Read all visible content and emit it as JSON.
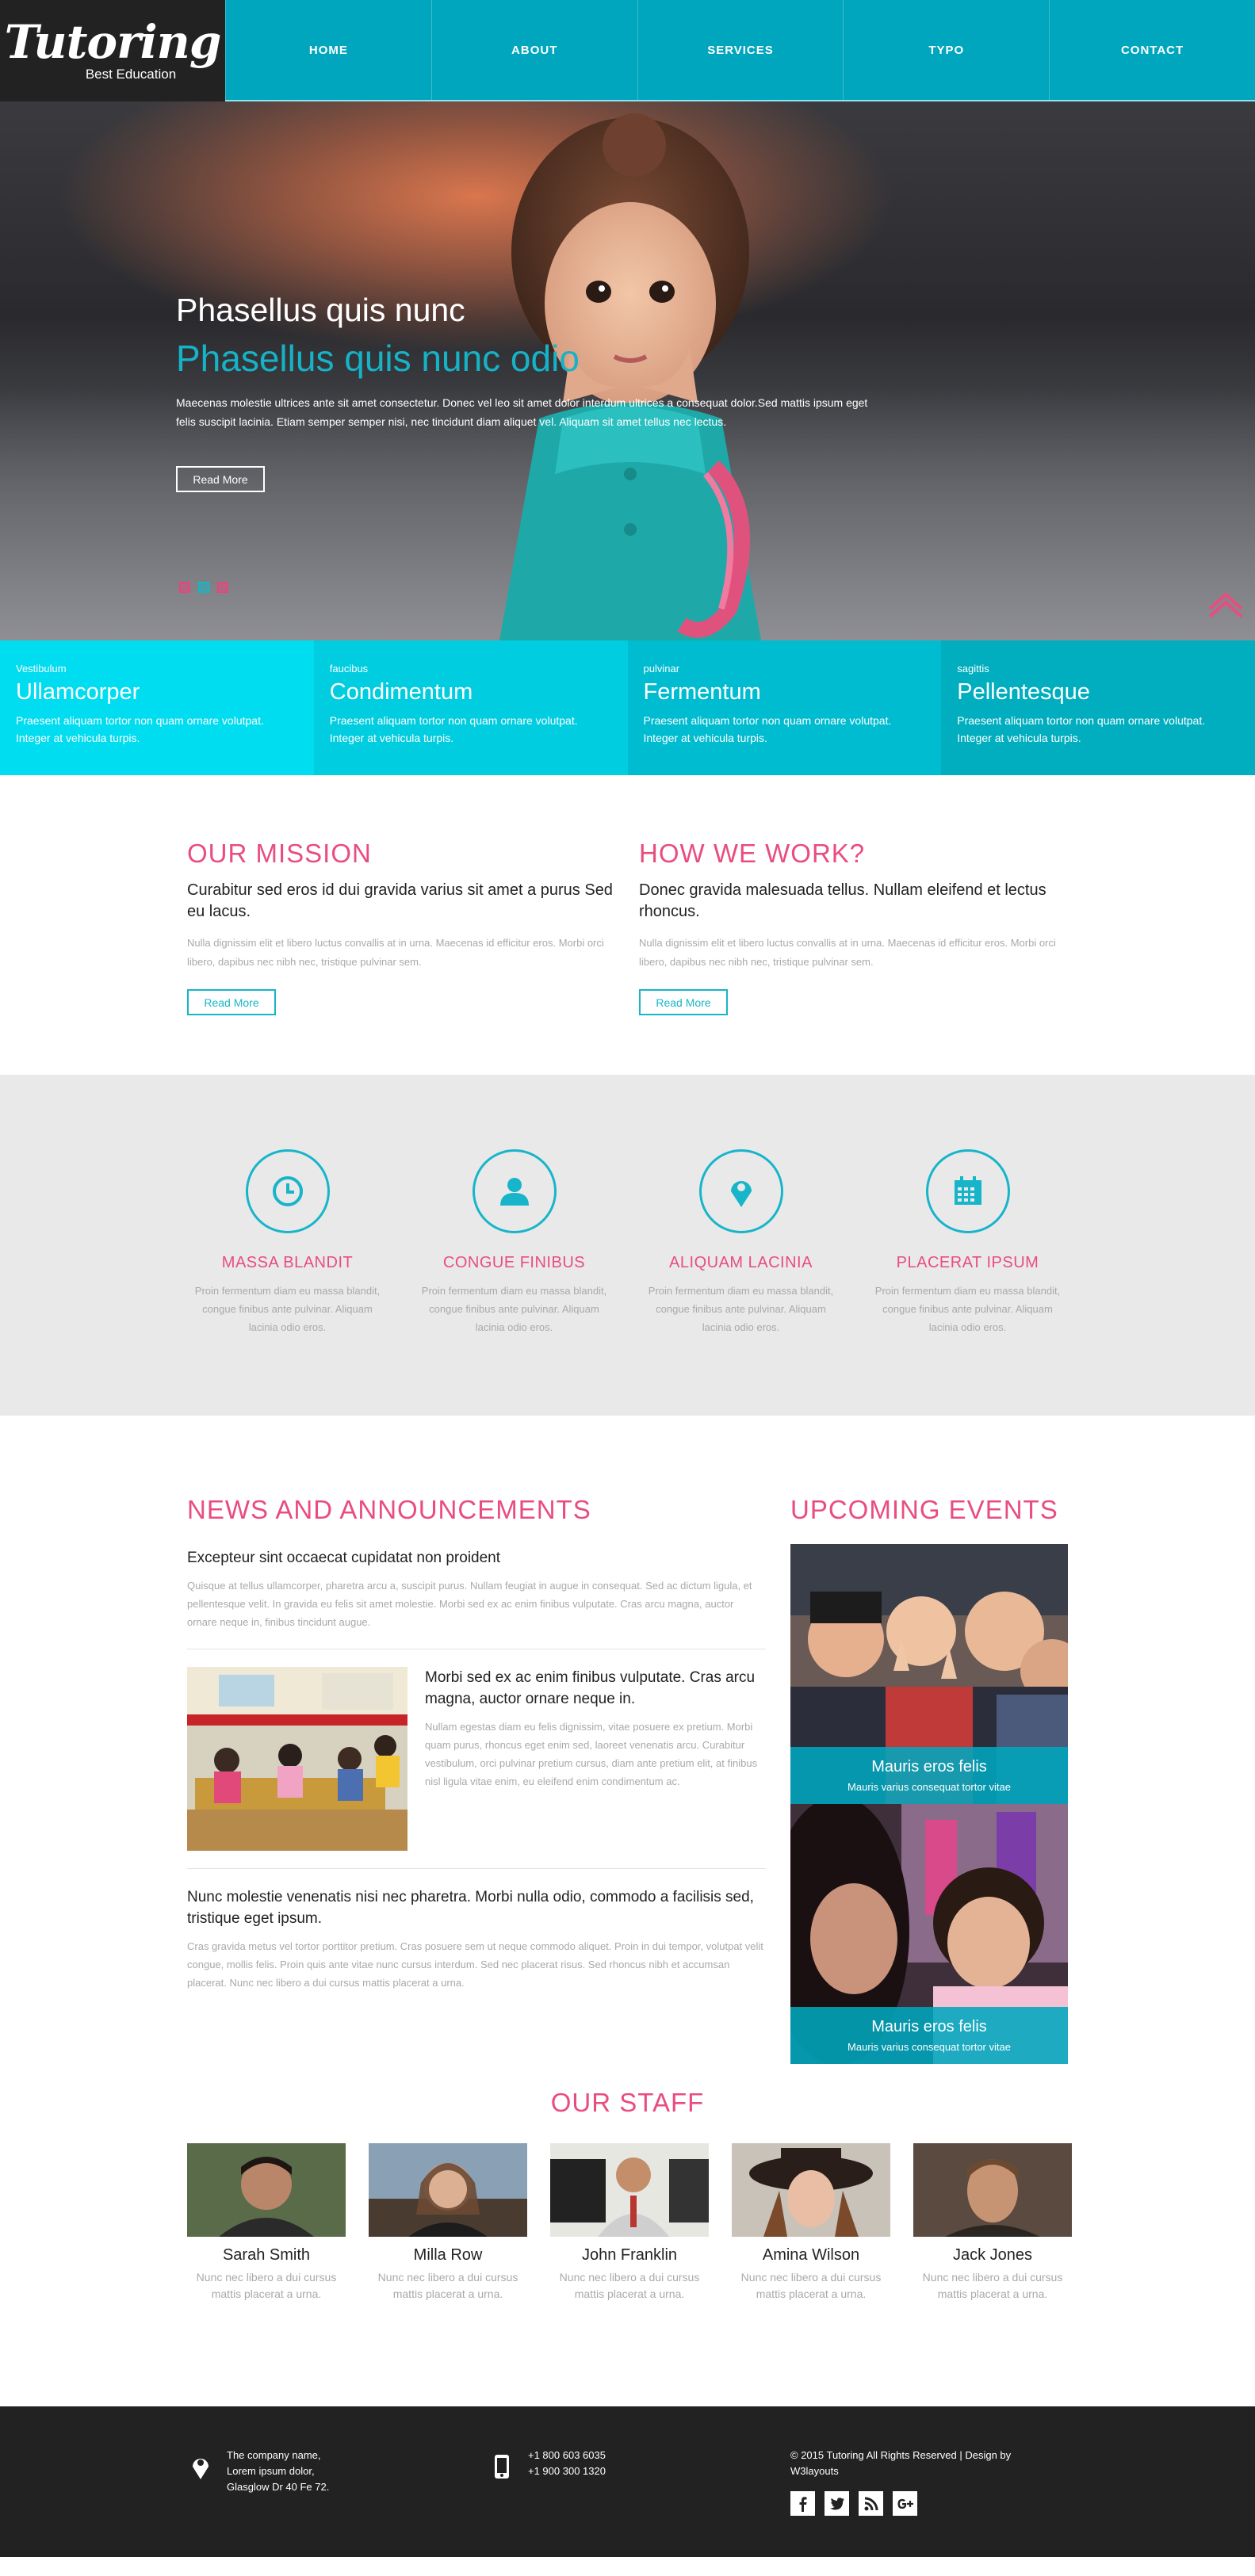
{
  "brand": {
    "name": "Tutoring",
    "tagline": "Best Education"
  },
  "nav": {
    "items": [
      "HOME",
      "ABOUT",
      "SERVICES",
      "TYPO",
      "CONTACT"
    ]
  },
  "hero": {
    "title": "Phasellus quis nunc",
    "subtitle": "Phasellus quis nunc odio",
    "text": "Maecenas molestie ultrices ante sit amet consectetur. Donec vel leo sit amet dolor interdum ultrices a consequat dolor.Sed mattis ipsum eget felis suscipit lacinia. Etiam semper semper nisi, nec tincidunt diam aliquet vel. Aliquam sit amet tellus nec lectus.",
    "button": "Read More"
  },
  "features": [
    {
      "tag": "Vestibulum",
      "title": "Ullamcorper",
      "text": "Praesent aliquam tortor non quam ornare volutpat. Integer at vehicula turpis.",
      "color": "#00dcf0"
    },
    {
      "tag": "faucibus",
      "title": "Condimentum",
      "text": "Praesent aliquam tortor non quam ornare volutpat. Integer at vehicula turpis.",
      "color": "#00cde0"
    },
    {
      "tag": "pulvinar",
      "title": "Fermentum",
      "text": "Praesent aliquam tortor non quam ornare volutpat. Integer at vehicula turpis.",
      "color": "#00bcd0"
    },
    {
      "tag": "sagittis",
      "title": "Pellentesque",
      "text": "Praesent aliquam tortor non quam ornare volutpat. Integer at vehicula turpis.",
      "color": "#00aebf"
    }
  ],
  "mission": {
    "left": {
      "title": "OUR MISSION",
      "subtitle": "Curabitur sed eros id dui gravida varius sit amet a purus Sed eu lacus.",
      "text": "Nulla dignissim elit et libero luctus convallis at in urna. Maecenas id efficitur eros. Morbi orci libero, dapibus nec nibh nec, tristique pulvinar sem.",
      "button": "Read More"
    },
    "right": {
      "title": "HOW WE WORK?",
      "subtitle": "Donec gravida malesuada tellus. Nullam eleifend et lectus rhoncus.",
      "text": "Nulla dignissim elit et libero luctus convallis at in urna. Maecenas id efficitur eros. Morbi orci libero, dapibus nec nibh nec, tristique pulvinar sem.",
      "button": "Read More"
    }
  },
  "services": [
    {
      "icon": "clock-icon",
      "title": "MASSA BLANDIT",
      "text": "Proin fermentum diam eu massa blandit, congue finibus ante pulvinar. Aliquam lacinia odio eros."
    },
    {
      "icon": "user-icon",
      "title": "CONGUE FINIBUS",
      "text": "Proin fermentum diam eu massa blandit, congue finibus ante pulvinar. Aliquam lacinia odio eros."
    },
    {
      "icon": "map-marker-icon",
      "title": "ALIQUAM LACINIA",
      "text": "Proin fermentum diam eu massa blandit, congue finibus ante pulvinar. Aliquam lacinia odio eros."
    },
    {
      "icon": "calendar-icon",
      "title": "PLACERAT IPSUM",
      "text": "Proin fermentum diam eu massa blandit, congue finibus ante pulvinar. Aliquam lacinia odio eros."
    }
  ],
  "news": {
    "title": "NEWS AND ANNOUNCEMENTS",
    "items": [
      {
        "subtitle": "Excepteur sint occaecat cupidatat non proident",
        "text": "Quisque at tellus ullamcorper, pharetra arcu a, suscipit purus. Nullam feugiat in augue in consequat. Sed ac dictum ligula, et pellentesque velit. In gravida eu felis sit amet molestie. Morbi sed ex ac enim finibus vulputate. Cras arcu magna, auctor ornare neque in, finibus tincidunt augue."
      },
      {
        "subtitle": "Morbi sed ex ac enim finibus vulputate. Cras arcu magna, auctor ornare neque in.",
        "text": "Nullam egestas diam eu felis dignissim, vitae posuere ex pretium. Morbi quam purus, rhoncus eget enim sed, laoreet venenatis arcu. Curabitur vestibulum, orci pulvinar pretium cursus, diam ante pretium elit, at finibus nisl ligula vitae enim, eu eleifend enim condimentum ac."
      },
      {
        "subtitle": "Nunc molestie venenatis nisi nec pharetra. Morbi nulla odio, commodo a facilisis sed, tristique eget ipsum.",
        "text": "Cras gravida metus vel tortor porttitor pretium. Cras posuere sem ut neque commodo aliquet. Proin in dui tempor, volutpat velit congue, mollis felis. Proin quis ante vitae nunc cursus interdum. Sed nec placerat risus. Sed rhoncus nibh et accumsan placerat. Nunc nec libero a dui cursus mattis placerat a urna."
      }
    ]
  },
  "events": {
    "title": "UPCOMING EVENTS",
    "items": [
      {
        "title": "Mauris eros felis",
        "subtitle": "Mauris varius consequat tortor vitae"
      },
      {
        "title": "Mauris eros felis",
        "subtitle": "Mauris varius consequat tortor vitae"
      }
    ]
  },
  "staff": {
    "title": "OUR STAFF",
    "members": [
      {
        "name": "Sarah Smith",
        "text": "Nunc nec libero a dui cursus mattis placerat a urna."
      },
      {
        "name": "Milla Row",
        "text": "Nunc nec libero a dui cursus mattis placerat a urna."
      },
      {
        "name": "John Franklin",
        "text": "Nunc nec libero a dui cursus mattis placerat a urna."
      },
      {
        "name": "Amina Wilson",
        "text": "Nunc nec libero a dui cursus mattis placerat a urna."
      },
      {
        "name": "Jack Jones",
        "text": "Nunc nec libero a dui cursus mattis placerat a urna."
      }
    ]
  },
  "footer": {
    "address": [
      "The company name,",
      "Lorem ipsum dolor,",
      "Glasglow Dr 40 Fe 72."
    ],
    "phones": [
      "+1 800 603 6035",
      "+1 900 300 1320"
    ],
    "copyright": "© 2015 Tutoring All Rights Reserved | Design by W3layouts",
    "social": [
      "facebook-icon",
      "twitter-icon",
      "rss-icon",
      "google-plus-icon"
    ]
  },
  "colors": {
    "teal": "#00a6bd",
    "pink": "#e94d7f",
    "dark": "#222222",
    "light_gray": "#e9e9e9"
  }
}
